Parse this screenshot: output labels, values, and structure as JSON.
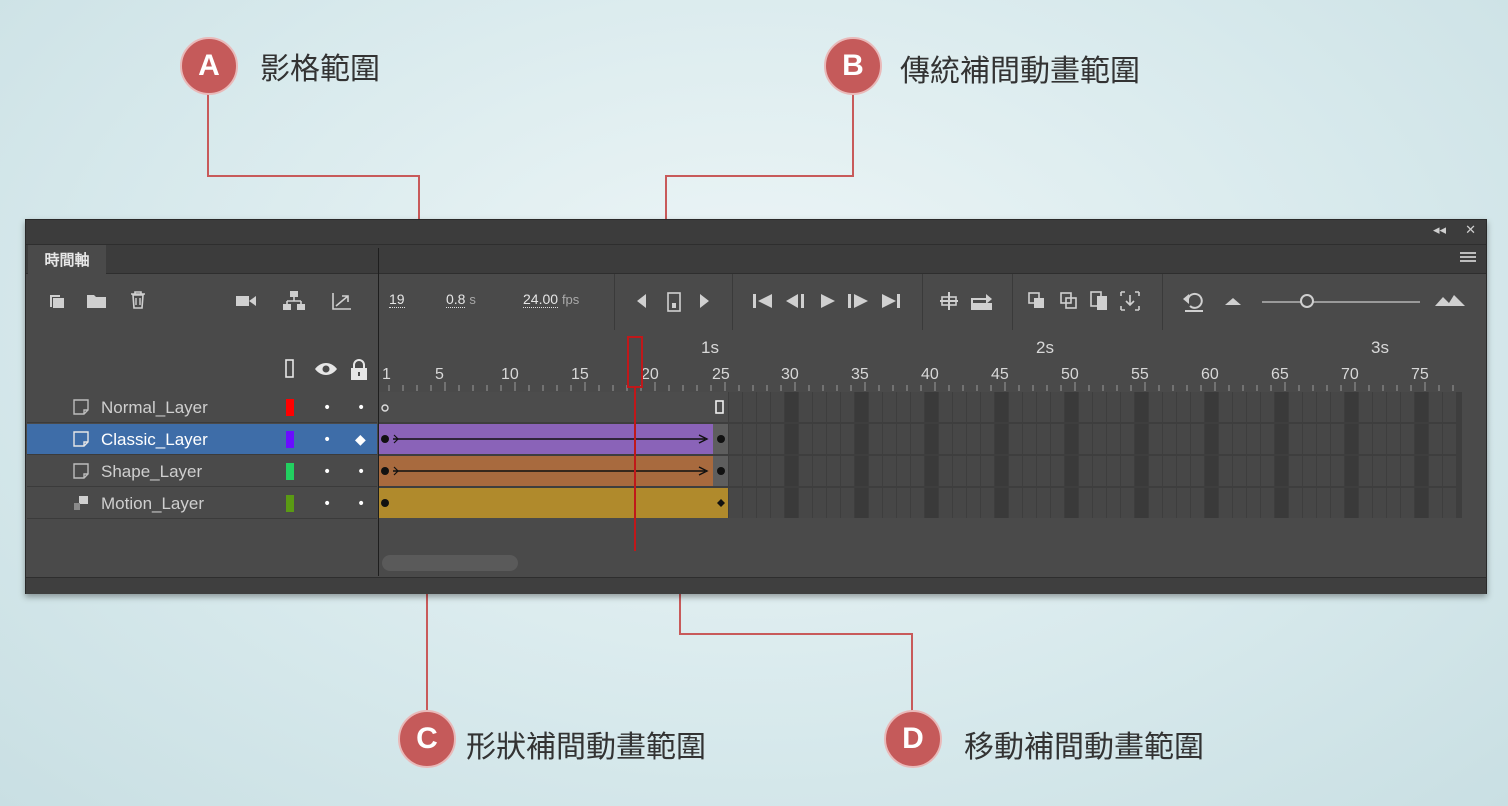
{
  "callouts": {
    "a": {
      "letter": "A",
      "label": "影格範圍"
    },
    "b": {
      "letter": "B",
      "label": "傳統補間動畫範圍"
    },
    "c": {
      "letter": "C",
      "label": "形狀補間動畫範圍"
    },
    "d": {
      "letter": "D",
      "label": "移動補間動畫範圍"
    }
  },
  "colors": {
    "callout": "#c55a5a",
    "leader": "#c85a5a",
    "panel": "#4a4a4a",
    "selected_row": "#3e6da8",
    "playhead": "#c0181a"
  },
  "panel": {
    "collapse_icon": "◂◂",
    "close_icon": "✕",
    "tab_label": "時間軸",
    "menu_icon": "panel-menu-icon"
  },
  "toolbar": {
    "current_frame": "19",
    "elapsed_value": "0.8",
    "elapsed_unit": "s",
    "fps_value": "24.00",
    "fps_unit": "fps",
    "icons": [
      "new-layer-icon",
      "new-folder-icon",
      "delete-icon",
      "camera-icon",
      "parent-icon",
      "graph-icon",
      "step-back-icon",
      "center-frame-icon",
      "step-forward-icon",
      "first-frame-icon",
      "prev-frame-icon",
      "play-icon",
      "next-frame-icon",
      "last-frame-icon",
      "insert-frame-icon",
      "loop-icon",
      "onion-skin-icon",
      "onion-outline-icon",
      "edit-multiple-icon",
      "marker-icon",
      "undo-icon",
      "zoom-out-icon",
      "zoom-in-icon"
    ],
    "zoom_level": 0.3
  },
  "ruler": {
    "frames": [
      "1",
      "5",
      "10",
      "15",
      "20",
      "25",
      "30",
      "35",
      "40",
      "45",
      "50",
      "55",
      "60",
      "65",
      "70",
      "75"
    ],
    "seconds": [
      "1s",
      "2s",
      "3s"
    ]
  },
  "playhead_frame": 19,
  "layers": [
    {
      "name": "Normal_Layer",
      "color": "#ff0000",
      "selected": false,
      "type": "normal",
      "span_end": 25
    },
    {
      "name": "Classic_Layer",
      "color": "#6a0dff",
      "selected": true,
      "type": "classic",
      "span_end": 25
    },
    {
      "name": "Shape_Layer",
      "color": "#22d060",
      "selected": false,
      "type": "shape",
      "span_end": 25
    },
    {
      "name": "Motion_Layer",
      "color": "#5a9a14",
      "selected": false,
      "type": "motion",
      "span_end": 25
    }
  ]
}
